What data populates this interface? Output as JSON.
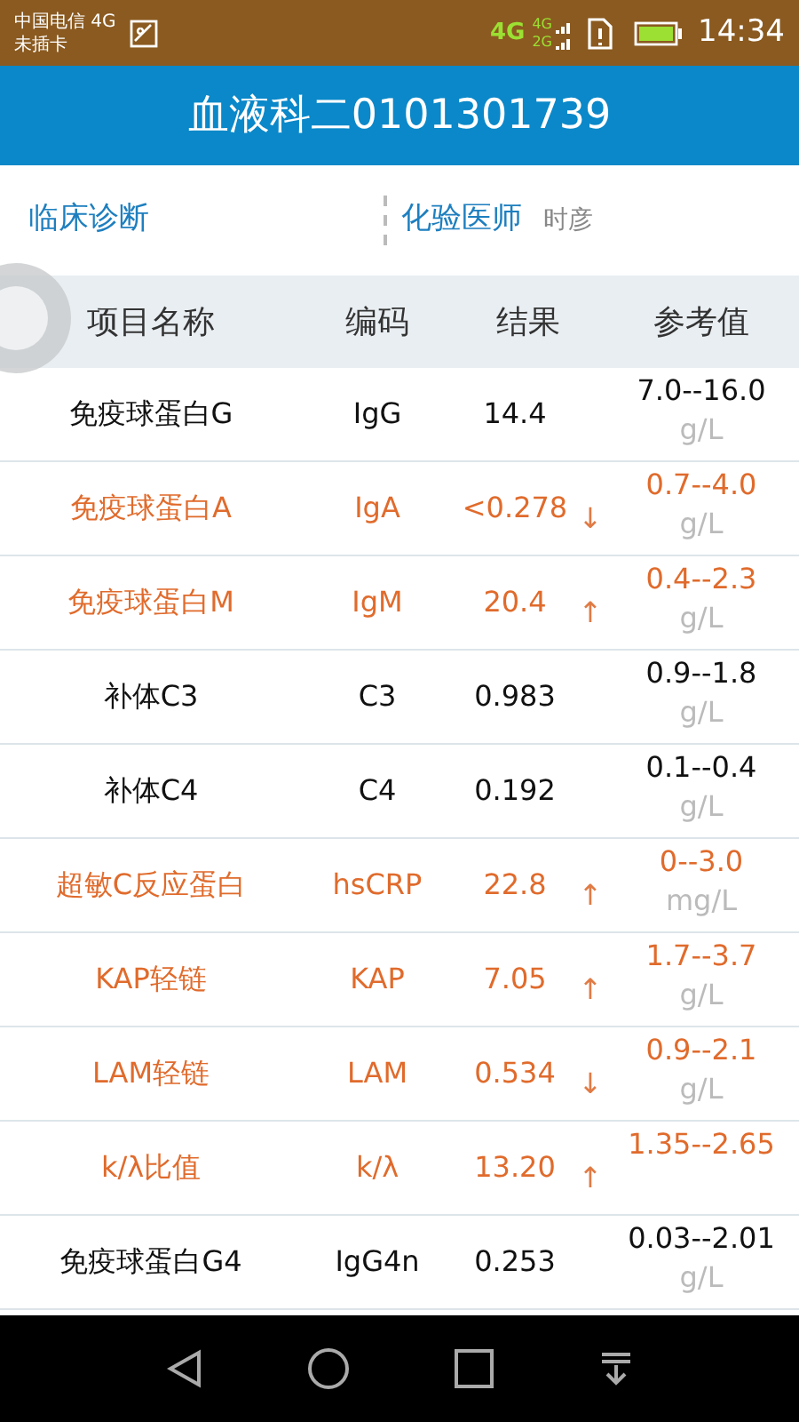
{
  "status_bar": {
    "carrier": "中国电信 4G",
    "sim_status": "未插卡",
    "network": "4G",
    "signal_labels": [
      "4G",
      "2G"
    ],
    "time": "14:34"
  },
  "header": {
    "title": "血液科二0101301739"
  },
  "info": {
    "diagnosis_label": "临床诊断",
    "doctor_label": "化验医师",
    "doctor_name": "时彦"
  },
  "table": {
    "columns": [
      "项目名称",
      "编码",
      "结果",
      "参考值"
    ],
    "rows": [
      {
        "name": "免疫球蛋白G",
        "code": "IgG",
        "result": "14.4",
        "abnormal": false,
        "range": "7.0--16.0",
        "unit": "g/L"
      },
      {
        "name": "免疫球蛋白A",
        "code": "IgA",
        "result": "<0.278",
        "abnormal": true,
        "arrow": "↓",
        "range": "0.7--4.0",
        "unit": "g/L"
      },
      {
        "name": "免疫球蛋白M",
        "code": "IgM",
        "result": "20.4",
        "abnormal": true,
        "arrow": "↑",
        "range": "0.4--2.3",
        "unit": "g/L"
      },
      {
        "name": "补体C3",
        "code": "C3",
        "result": "0.983",
        "abnormal": false,
        "range": "0.9--1.8",
        "unit": "g/L"
      },
      {
        "name": "补体C4",
        "code": "C4",
        "result": "0.192",
        "abnormal": false,
        "range": "0.1--0.4",
        "unit": "g/L"
      },
      {
        "name": "超敏C反应蛋白",
        "code": "hsCRP",
        "result": "22.8",
        "abnormal": true,
        "arrow": "↑",
        "range": "0--3.0",
        "unit": "mg/L"
      },
      {
        "name": "KAP轻链",
        "code": "KAP",
        "result": "7.05",
        "abnormal": true,
        "arrow": "↑",
        "range": "1.7--3.7",
        "unit": "g/L"
      },
      {
        "name": "LAM轻链",
        "code": "LAM",
        "result": "0.534",
        "abnormal": true,
        "arrow": "↓",
        "range": "0.9--2.1",
        "unit": "g/L"
      },
      {
        "name": "k/λ比值",
        "code": "k/λ",
        "result": "13.20",
        "abnormal": true,
        "arrow": "↑",
        "range": "1.35--2.65"
      },
      {
        "name": "免疫球蛋白G4",
        "code": "IgG4n",
        "result": "0.253",
        "abnormal": false,
        "range": "0.03--2.01",
        "unit": "g/L"
      }
    ]
  }
}
